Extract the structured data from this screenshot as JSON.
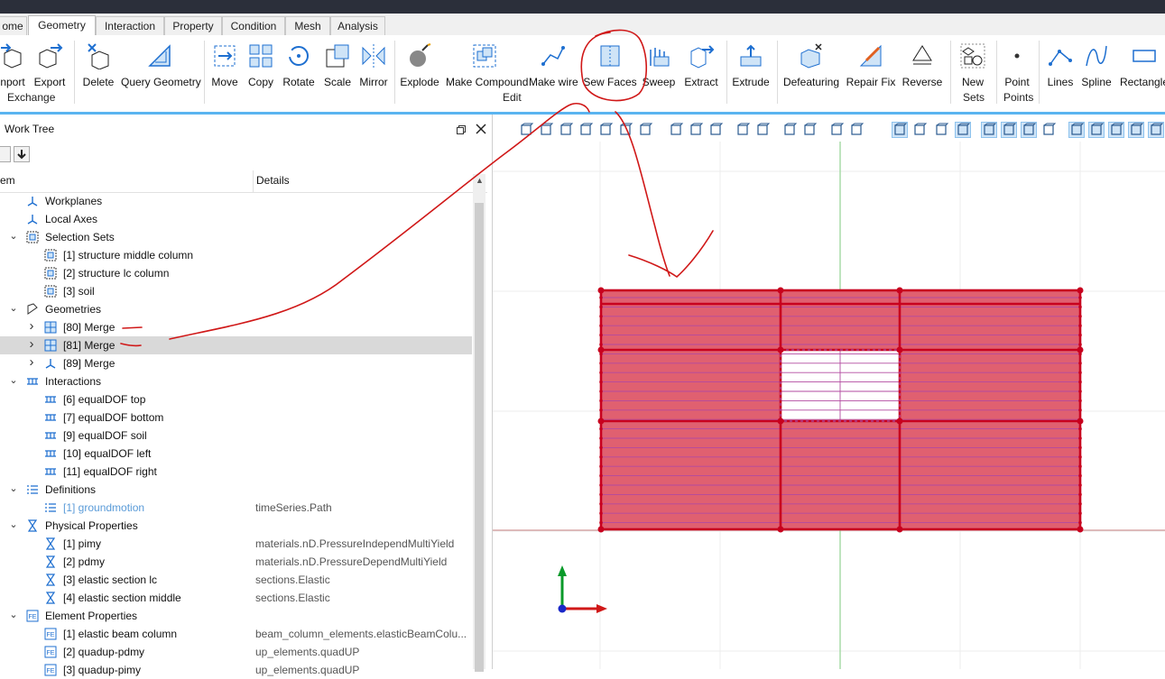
{
  "tabs": [
    {
      "label": "ome",
      "active": false
    },
    {
      "label": "Geometry",
      "active": true
    },
    {
      "label": "Interaction",
      "active": false
    },
    {
      "label": "Property",
      "active": false
    },
    {
      "label": "Condition",
      "active": false
    },
    {
      "label": "Mesh",
      "active": false
    },
    {
      "label": "Analysis",
      "active": false
    }
  ],
  "ribbon": {
    "buttons": [
      {
        "label": "nport",
        "icon": "import-icon"
      },
      {
        "label": "Export",
        "icon": "export-icon"
      },
      {
        "label": "Delete",
        "icon": "delete-icon"
      },
      {
        "label": "Query Geometry",
        "icon": "query-geometry-icon"
      },
      {
        "label": "Move",
        "icon": "move-icon"
      },
      {
        "label": "Copy",
        "icon": "copy-icon"
      },
      {
        "label": "Rotate",
        "icon": "rotate-icon"
      },
      {
        "label": "Scale",
        "icon": "scale-icon"
      },
      {
        "label": "Mirror",
        "icon": "mirror-icon"
      },
      {
        "label": "Explode",
        "icon": "explode-icon"
      },
      {
        "label": "Make Compound",
        "icon": "make-compound-icon"
      },
      {
        "label": "Make wire",
        "icon": "make-wire-icon"
      },
      {
        "label": "Sew Faces",
        "icon": "sew-faces-icon"
      },
      {
        "label": "Sweep",
        "icon": "sweep-icon"
      },
      {
        "label": "Extract",
        "icon": "extract-icon"
      },
      {
        "label": "Extrude",
        "icon": "extrude-icon"
      },
      {
        "label": "Defeaturing",
        "icon": "defeaturing-icon"
      },
      {
        "label": "Repair Fix",
        "icon": "repair-fix-icon"
      },
      {
        "label": "Reverse",
        "icon": "reverse-icon"
      },
      {
        "label": "New",
        "icon": "new-sets-icon"
      },
      {
        "label": "Point",
        "icon": "point-icon"
      },
      {
        "label": "Lines",
        "icon": "lines-icon"
      },
      {
        "label": "Spline",
        "icon": "spline-icon"
      },
      {
        "label": "Rectangle",
        "icon": "rectangle-icon"
      }
    ],
    "groups": {
      "exchange": "Exchange",
      "edit": "Edit",
      "sets": "Sets",
      "points": "Points"
    }
  },
  "panel": {
    "title": "Work Tree",
    "col_item": "em",
    "col_details": "Details"
  },
  "tree": [
    {
      "label": "Workplanes",
      "details": "",
      "level": 1,
      "expander": "",
      "icon": "workplanes-icon"
    },
    {
      "label": "Local Axes",
      "details": "",
      "level": 1,
      "expander": "",
      "icon": "local-axes-icon"
    },
    {
      "label": "Selection Sets",
      "details": "",
      "level": 1,
      "expander": "v",
      "icon": "selection-sets-icon"
    },
    {
      "label": "[1] structure middle column",
      "details": "",
      "level": 2,
      "expander": "",
      "icon": "selection-set-icon"
    },
    {
      "label": "[2] structure lc column",
      "details": "",
      "level": 2,
      "expander": "",
      "icon": "selection-set-icon"
    },
    {
      "label": "[3] soil",
      "details": "",
      "level": 2,
      "expander": "",
      "icon": "selection-set-icon"
    },
    {
      "label": "Geometries",
      "details": "",
      "level": 1,
      "expander": "v",
      "icon": "geometries-icon"
    },
    {
      "label": "[80] Merge",
      "details": "",
      "level": 2,
      "expander": ">",
      "icon": "merge-geometry-icon"
    },
    {
      "label": "[81] Merge",
      "details": "",
      "level": 2,
      "expander": ">",
      "icon": "merge-geometry-icon",
      "selected": true
    },
    {
      "label": "[89] Merge",
      "details": "",
      "level": 2,
      "expander": ">",
      "icon": "merge-wire-icon"
    },
    {
      "label": "Interactions",
      "details": "",
      "level": 1,
      "expander": "v",
      "icon": "interactions-icon"
    },
    {
      "label": "[6] equalDOF top",
      "details": "",
      "level": 2,
      "expander": "",
      "icon": "equaldof-icon"
    },
    {
      "label": "[7] equalDOF bottom",
      "details": "",
      "level": 2,
      "expander": "",
      "icon": "equaldof-icon"
    },
    {
      "label": "[9] equalDOF soil",
      "details": "",
      "level": 2,
      "expander": "",
      "icon": "equaldof-icon"
    },
    {
      "label": "[10] equalDOF left",
      "details": "",
      "level": 2,
      "expander": "",
      "icon": "equaldof-icon"
    },
    {
      "label": "[11] equalDOF right",
      "details": "",
      "level": 2,
      "expander": "",
      "icon": "equaldof-icon"
    },
    {
      "label": "Definitions",
      "details": "",
      "level": 1,
      "expander": "v",
      "icon": "definitions-icon"
    },
    {
      "label": "[1] groundmotion",
      "details": "timeSeries.Path",
      "level": 2,
      "expander": "",
      "icon": "definition-item-icon",
      "muted": true
    },
    {
      "label": "Physical Properties",
      "details": "",
      "level": 1,
      "expander": "v",
      "icon": "physical-properties-icon"
    },
    {
      "label": "[1] pimy",
      "details": "materials.nD.PressureIndependMultiYield",
      "level": 2,
      "expander": "",
      "icon": "material-icon"
    },
    {
      "label": "[2] pdmy",
      "details": "materials.nD.PressureDependMultiYield",
      "level": 2,
      "expander": "",
      "icon": "material-icon"
    },
    {
      "label": "[3] elastic section lc",
      "details": "sections.Elastic",
      "level": 2,
      "expander": "",
      "icon": "material-icon"
    },
    {
      "label": "[4] elastic section middle",
      "details": "sections.Elastic",
      "level": 2,
      "expander": "",
      "icon": "material-icon"
    },
    {
      "label": "Element Properties",
      "details": "",
      "level": 1,
      "expander": "v",
      "icon": "element-properties-icon"
    },
    {
      "label": "[1] elastic beam column",
      "details": "beam_column_elements.elasticBeamColu...",
      "level": 2,
      "expander": "",
      "icon": "element-icon"
    },
    {
      "label": "[2] quadup-pdmy",
      "details": "up_elements.quadUP",
      "level": 2,
      "expander": "",
      "icon": "element-icon"
    },
    {
      "label": "[3] quadup-pimy",
      "details": "up_elements.quadUP",
      "level": 2,
      "expander": "",
      "icon": "element-icon"
    }
  ],
  "colors": {
    "accent": "#5ab4f0",
    "mesh_fill": "#e06070",
    "mesh_edge": "#c8001e",
    "annotation": "#d01818"
  }
}
